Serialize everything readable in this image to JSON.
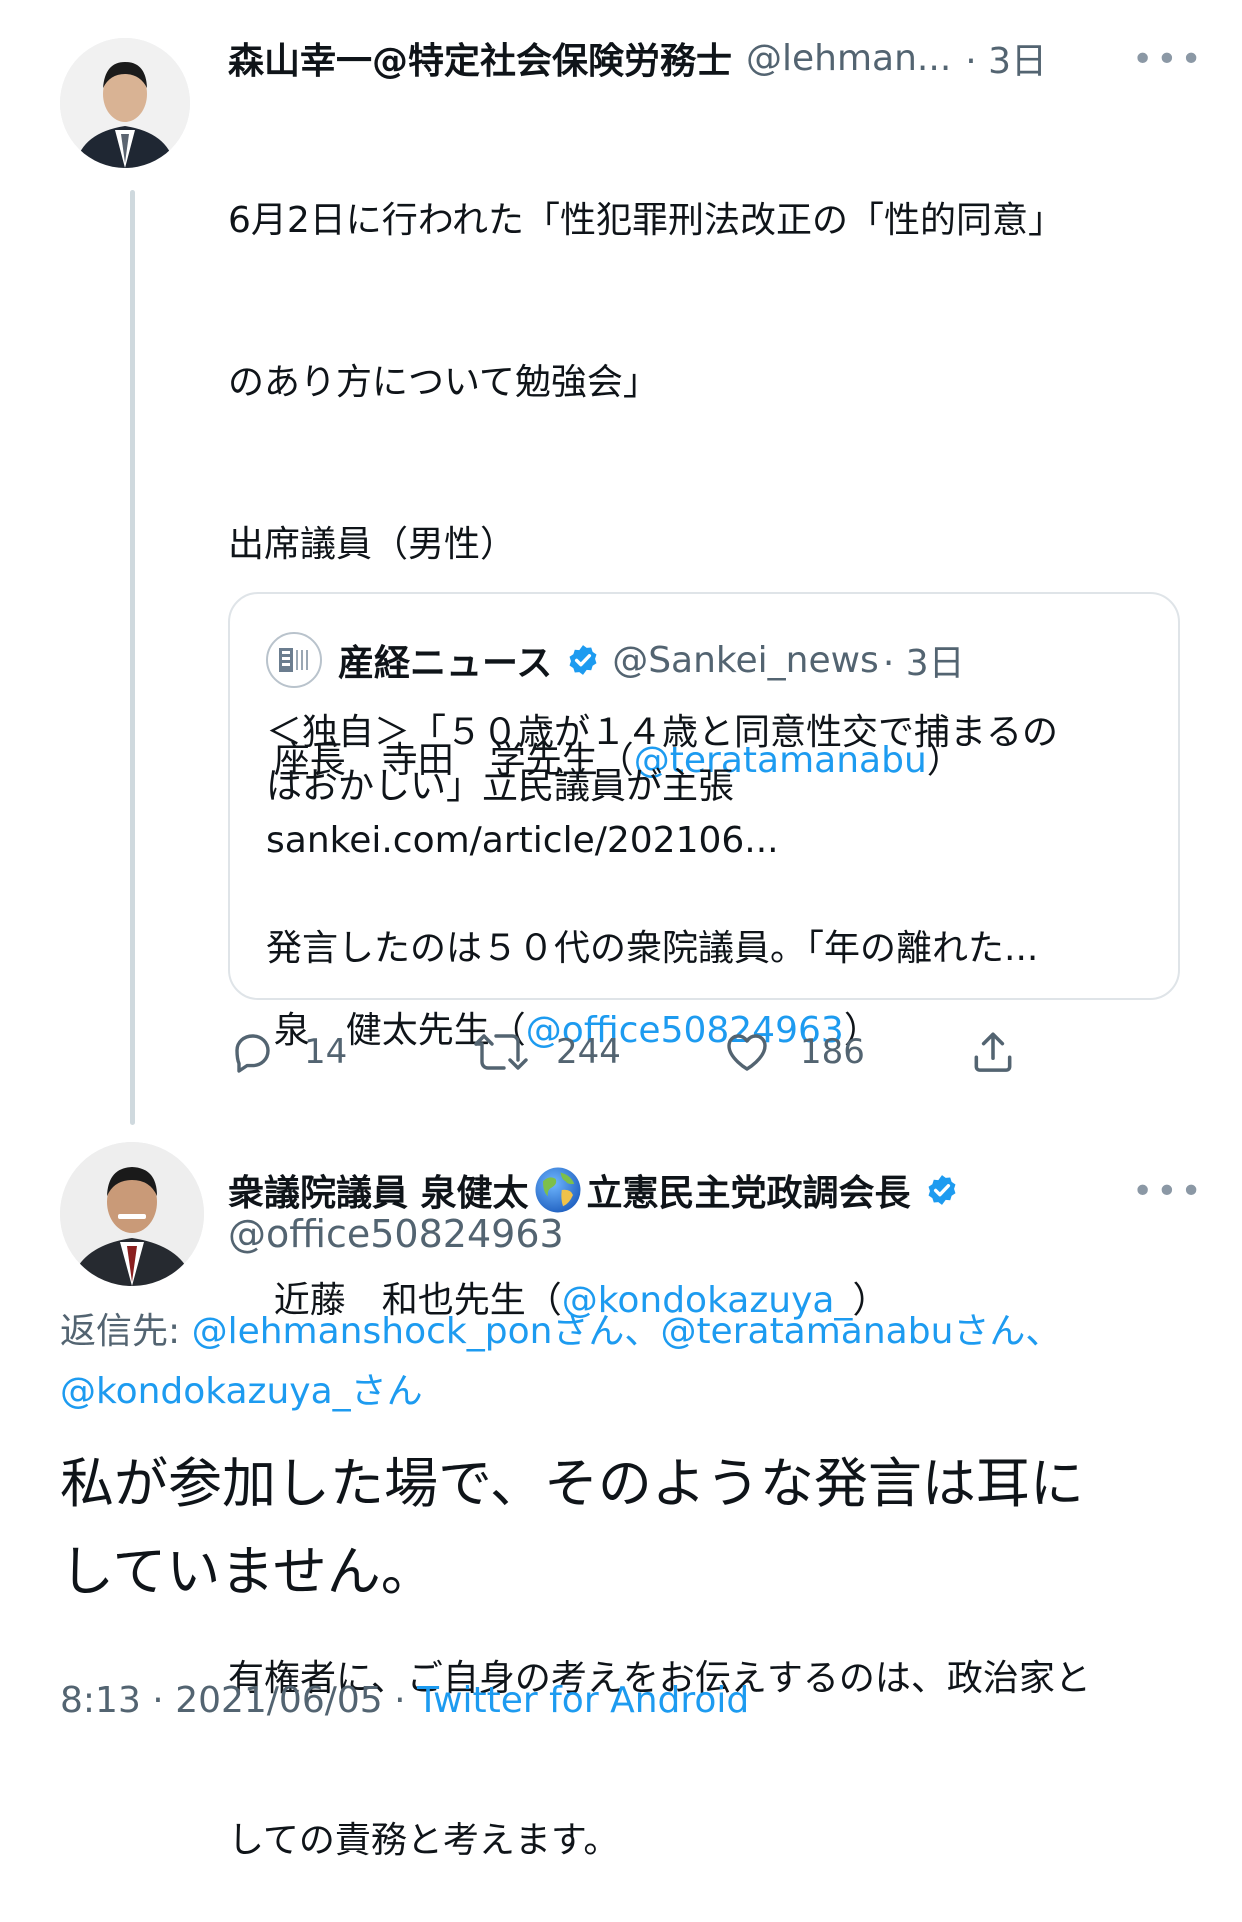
{
  "tweet1": {
    "author_name": "森山幸一@特定社会保険労務士",
    "author_handle": "@lehman...",
    "time": "· 3日",
    "more": "•••",
    "lines": [
      {
        "text": "6月2日に行われた「性犯罪刑法改正の「性的同意」"
      },
      {
        "text": "のあり方について勉強会」"
      },
      {
        "text": "出席議員（男性）"
      },
      {
        "pre": "座長　寺田　学先生（",
        "link": "@teratamanabu",
        "post": "）"
      },
      {
        "pre": "泉　健太先生（",
        "link": "@office50824963",
        "post": "）"
      },
      {
        "pre": "近藤　和也先生（",
        "link": "@kondokazuya_",
        "post": "）"
      },
      {
        "text": ""
      },
      {
        "text": "有権者に、ご自身の考えをお伝えするのは、政治家と"
      },
      {
        "text": "しての責務と考えます。"
      }
    ],
    "quote": {
      "name": "産経ニュース",
      "handle": "@Sankei_news",
      "time": "· 3日",
      "text": "＜独自＞「５０歳が１４歳と同意性交で捕まるの\nはおかしい」立民議員が主張\nsankei.com/article/202106...\n\n発言したのは５０代の衆院議員。「年の離れた..."
    },
    "actions": {
      "reply_count": "14",
      "retweet_count": "244",
      "like_count": "186"
    }
  },
  "tweet2": {
    "author_name_part1": "衆議院議員 泉健太",
    "author_name_part2": "立憲民主党政調会長",
    "author_handle": "@office50824963",
    "more": "•••",
    "reply_prefix": "返信先: ",
    "reply_users": [
      {
        "handle": "@lehmanshock_pon",
        "suffix": "さん、"
      },
      {
        "handle": "@teratamanabu",
        "suffix": "さん、"
      },
      {
        "handle": "@kondokazuya_",
        "suffix": "さん"
      }
    ],
    "text": "私が参加した場で、そのような発言は耳に\nしていません。",
    "time": "8:13",
    "date": "2021/06/05",
    "separator": " · ",
    "source": "Twitter for Android"
  },
  "colors": {
    "link": "#1d9bf0",
    "muted": "#536471",
    "border": "#dfe4e8",
    "verified": "#1d9bf0"
  },
  "icons": [
    "reply-icon",
    "retweet-icon",
    "like-icon",
    "share-icon",
    "verified-icon",
    "globe-icon",
    "more-icon"
  ]
}
